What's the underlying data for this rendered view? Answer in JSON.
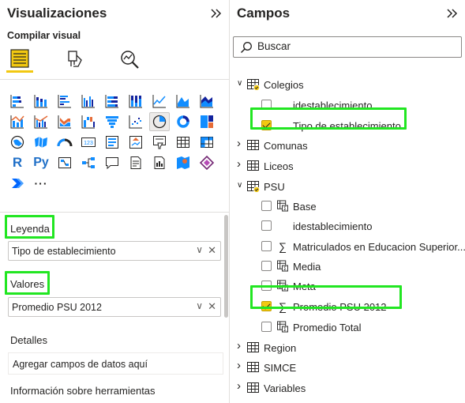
{
  "visualizations": {
    "title": "Visualizaciones",
    "collapse_icon": "double-chevron-right",
    "build_label": "Compilar visual",
    "mode_icons": [
      "build-visual-icon",
      "format-paintbrush-icon",
      "analytics-magnifier-icon"
    ],
    "visual_types": [
      "stacked-bar-chart-icon",
      "stacked-column-chart-icon",
      "clustered-bar-chart-icon",
      "clustered-column-chart-icon",
      "100-stacked-bar-chart-icon",
      "100-stacked-column-chart-icon",
      "line-chart-icon",
      "area-chart-icon",
      "stacked-area-chart-icon",
      "line-and-stacked-column-icon",
      "line-and-clustered-column-icon",
      "ribbon-chart-icon",
      "waterfall-chart-icon",
      "funnel-chart-icon",
      "scatter-chart-icon",
      "pie-chart-icon",
      "donut-chart-icon",
      "treemap-icon",
      "map-icon",
      "filled-map-icon",
      "gauge-icon",
      "card-icon",
      "multi-row-card-icon",
      "kpi-icon",
      "slicer-icon",
      "table-icon",
      "matrix-icon",
      "r-visual-icon",
      "python-visual-icon",
      "key-influencers-icon",
      "decomposition-tree-icon",
      "qa-icon",
      "smart-narrative-icon",
      "paginated-report-icon",
      "azure-map-icon",
      "power-apps-icon",
      "power-automate-icon",
      "more-visuals-icon"
    ],
    "selected_visual": "pie-chart-icon",
    "r_label": "R",
    "py_label": "Py",
    "more_label": "···",
    "card_label": "123",
    "wells": {
      "legend_label": "Leyenda",
      "legend_value": "Tipo de establecimiento",
      "values_label": "Valores",
      "values_value": "Promedio PSU 2012",
      "details_label": "Detalles",
      "details_placeholder": "Agregar campos de datos aquí",
      "tooltips_label": "Información sobre herramientas"
    },
    "chevron_glyph": "∨",
    "remove_glyph": "✕"
  },
  "fields": {
    "title": "Campos",
    "collapse_icon": "double-chevron-right",
    "search_placeholder": "Buscar",
    "tables": [
      {
        "name": "Colegios",
        "expanded": true,
        "has_selection": true,
        "fields": [
          {
            "name": "idestablecimiento",
            "checked": false,
            "icon": "none"
          },
          {
            "name": "Tipo de establecimiento",
            "checked": true,
            "icon": "none"
          }
        ]
      },
      {
        "name": "Comunas",
        "expanded": false
      },
      {
        "name": "Liceos",
        "expanded": false
      },
      {
        "name": "PSU",
        "expanded": true,
        "has_selection": true,
        "fields": [
          {
            "name": "Base",
            "checked": false,
            "icon": "calc-table-icon"
          },
          {
            "name": "idestablecimiento",
            "checked": false,
            "icon": "none"
          },
          {
            "name": "Matriculados en Educacion Superior...",
            "checked": false,
            "icon": "sigma-icon"
          },
          {
            "name": "Media",
            "checked": false,
            "icon": "calc-table-icon"
          },
          {
            "name": "Meta",
            "checked": false,
            "icon": "calc-table-icon"
          },
          {
            "name": "Promedio PSU 2012",
            "checked": true,
            "icon": "sigma-icon"
          },
          {
            "name": "Promedio Total",
            "checked": false,
            "icon": "calc-table-icon"
          }
        ]
      },
      {
        "name": "Region",
        "expanded": false
      },
      {
        "name": "SIMCE",
        "expanded": false
      },
      {
        "name": "Variables",
        "expanded": false
      }
    ],
    "glyphs": {
      "expanded": "∨",
      "collapsed": "›",
      "sigma": "∑"
    }
  },
  "colors": {
    "highlight_green": "#22e622",
    "check_yellow": "#f2c811",
    "icon_blue": "#118dff",
    "dark_blue": "#12239e",
    "orange": "#e66c37"
  }
}
